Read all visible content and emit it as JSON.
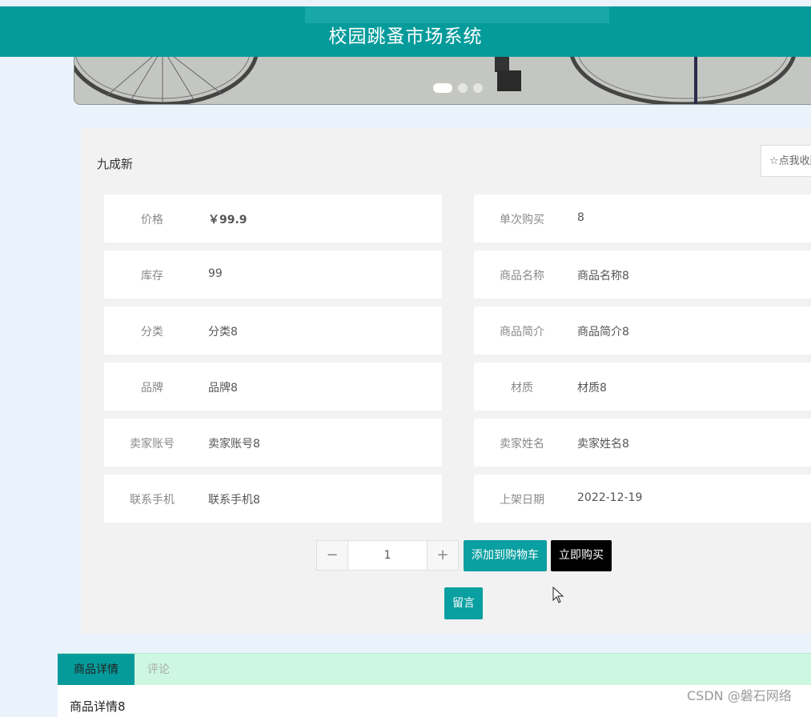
{
  "header": {
    "title": "校园跳蚤市场系统"
  },
  "banner": {
    "slides": 3,
    "active_slide": 1
  },
  "product": {
    "condition": "九成新",
    "favorite_label": "☆点我收藏",
    "fields_left": [
      {
        "label": "价格",
        "value": "￥99.9"
      },
      {
        "label": "库存",
        "value": "99"
      },
      {
        "label": "分类",
        "value": "分类8"
      },
      {
        "label": "品牌",
        "value": "品牌8"
      },
      {
        "label": "卖家账号",
        "value": "卖家账号8"
      },
      {
        "label": "联系手机",
        "value": "联系手机8"
      }
    ],
    "fields_right": [
      {
        "label": "单次购买",
        "value": "8"
      },
      {
        "label": "商品名称",
        "value": "商品名称8"
      },
      {
        "label": "商品简介",
        "value": "商品简介8"
      },
      {
        "label": "材质",
        "value": "材质8"
      },
      {
        "label": "卖家姓名",
        "value": "卖家姓名8"
      },
      {
        "label": "上架日期",
        "value": "2022-12-19"
      }
    ]
  },
  "actions": {
    "quantity": "1",
    "minus": "−",
    "plus": "+",
    "add_to_cart": "添加到购物车",
    "buy_now": "立即购买",
    "message": "留言"
  },
  "tabs": [
    {
      "label": "商品详情",
      "active": true
    },
    {
      "label": "评论",
      "active": false
    }
  ],
  "detail": {
    "text": "商品详情8"
  },
  "watermark": "CSDN @磐石网络",
  "colors": {
    "primary": "#069b9b",
    "tab_bar": "#cdf7e0",
    "buy_button": "#000000"
  }
}
